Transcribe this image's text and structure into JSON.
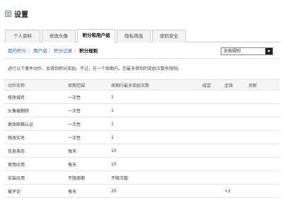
{
  "header": {
    "title": "设置"
  },
  "tabs": [
    {
      "label": "个人资料"
    },
    {
      "label": "修改头像"
    },
    {
      "label": "积分和用户组"
    },
    {
      "label": "隐私筛选"
    },
    {
      "label": "密码安全"
    }
  ],
  "active_tab": "积分和用户组",
  "subnav": {
    "items": [
      "我的积分",
      "用户组",
      "积分记录",
      "积分规则"
    ],
    "separator": "|",
    "current": "积分规则"
  },
  "rule_select": {
    "value": "全局规则"
  },
  "note": "进行以下事件动作，会得到积分奖励。不过，在一个周期内，您最多得到的奖励次数有限制。",
  "table": {
    "columns": [
      "动作名称",
      "周期范围",
      "周期内最多奖励次数",
      "威望",
      "金钱",
      "贡献"
    ],
    "rows": [
      [
        "修改域名",
        "一次性",
        "1",
        "",
        "",
        ""
      ],
      [
        "头像被删除",
        "一次性",
        "1",
        "",
        "",
        ""
      ],
      [
        "更改邮箱认证",
        "一次性",
        "1",
        "",
        "",
        ""
      ],
      [
        "修改实名",
        "一次性",
        "1",
        "",
        "",
        ""
      ],
      [
        "信息表态",
        "每天",
        "10",
        "",
        "",
        ""
      ],
      [
        "使用应用",
        "每天",
        "10",
        "",
        "",
        ""
      ],
      [
        "安装应用",
        "不限周期",
        "不限次数",
        "",
        "",
        ""
      ],
      [
        "被评论",
        "每天",
        "20",
        "",
        "+2",
        ""
      ]
    ]
  }
}
